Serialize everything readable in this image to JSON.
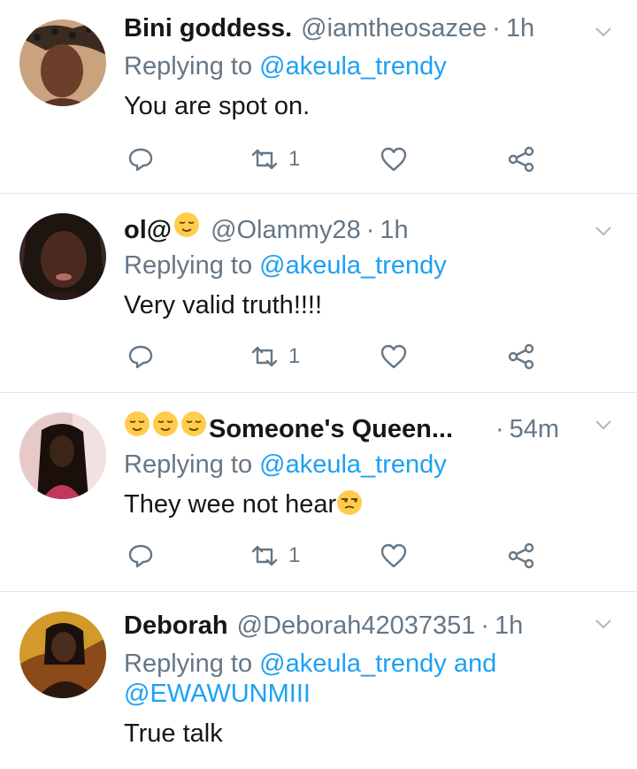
{
  "tweets": [
    {
      "name": "Bini goddess.",
      "handle": "@iamtheosazee",
      "time": "1h",
      "replying_prefix": "Replying to ",
      "replying_to": "@akeula_trendy",
      "replying_and": "",
      "replying_to2": "",
      "text": "You are spot on.",
      "retweets": "1",
      "colors": {
        "skin": "#6b3f2a",
        "bg": "#c9a27e",
        "accent": "#d9b48a"
      }
    },
    {
      "name": "ol@",
      "handle": "@Olammy28",
      "time": "1h",
      "replying_prefix": "Replying to ",
      "replying_to": "@akeula_trendy",
      "replying_and": "",
      "replying_to2": "",
      "text": "Very valid truth!!!!",
      "retweets": "1",
      "colors": {
        "skin": "#4a2a1e",
        "bg": "#3a2a26",
        "accent": "#b86a6a"
      }
    },
    {
      "name": "Someone's Queen...",
      "handle": "",
      "time": "54m",
      "replying_prefix": "Replying to ",
      "replying_to": "@akeula_trendy",
      "replying_and": "",
      "replying_to2": "",
      "text": "They wee not hear",
      "retweets": "1",
      "colors": {
        "skin": "#3b2518",
        "bg": "#e8c9c9",
        "accent": "#c0395a"
      }
    },
    {
      "name": "Deborah",
      "handle": "@Deborah42037351",
      "time": "1h",
      "replying_prefix": "Replying to ",
      "replying_to": "@akeula_trendy",
      "replying_and": " and",
      "replying_to2": "@EWAWUNMIII",
      "text": "True talk",
      "retweets": "",
      "colors": {
        "skin": "#4a2d1c",
        "bg": "#d29a2a",
        "accent": "#8a4a1a"
      }
    }
  ],
  "ui": {
    "separator": "·",
    "link_color": "#1da1f2",
    "muted_color": "#657786"
  }
}
